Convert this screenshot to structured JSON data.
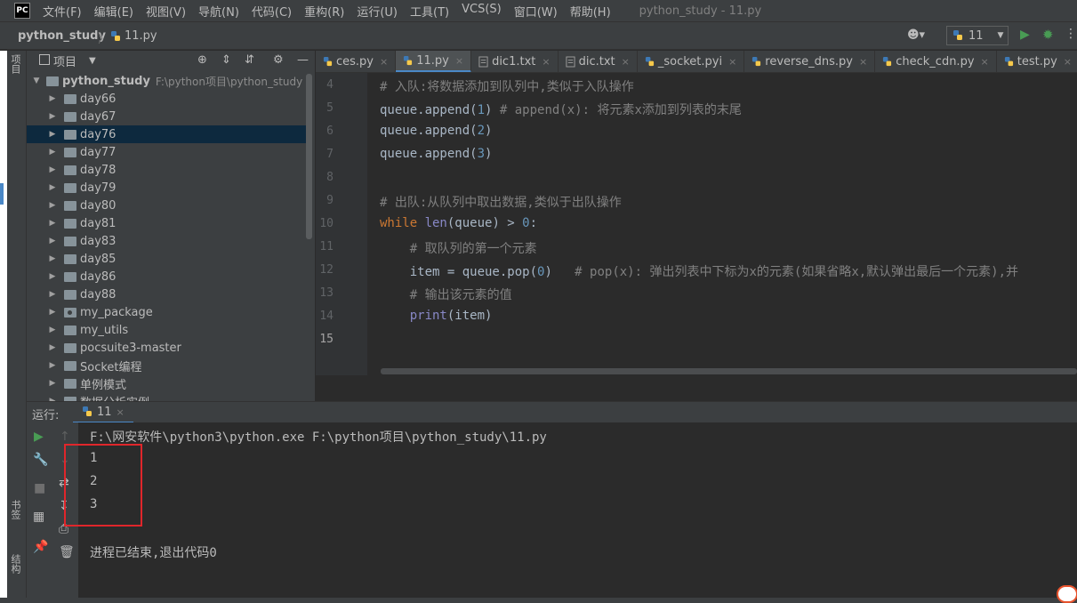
{
  "app": {
    "logo_text": "PC",
    "window_title": "python_study - 11.py",
    "menu": [
      "文件(F)",
      "编辑(E)",
      "视图(V)",
      "导航(N)",
      "代码(C)",
      "重构(R)",
      "运行(U)",
      "工具(T)",
      "VCS(S)",
      "窗口(W)",
      "帮助(H)"
    ]
  },
  "navbar": {
    "project": "python_study",
    "separator": "〉",
    "file": "11.py",
    "user_icon": "user-icon",
    "run_config": "11",
    "run_config_arrow": "▼"
  },
  "left_strip": {
    "project_tab": "项目",
    "bookmarks_tab": "书签",
    "structure_tab": "结构"
  },
  "project_panel": {
    "title": "项目",
    "dropdown": "▼",
    "root": {
      "name": "python_study",
      "path": "F:\\python项目\\python_study"
    },
    "items": [
      {
        "label": "day66",
        "selected": false,
        "package": false
      },
      {
        "label": "day67",
        "selected": false,
        "package": false
      },
      {
        "label": "day76",
        "selected": true,
        "package": false
      },
      {
        "label": "day77",
        "selected": false,
        "package": false
      },
      {
        "label": "day78",
        "selected": false,
        "package": false
      },
      {
        "label": "day79",
        "selected": false,
        "package": false
      },
      {
        "label": "day80",
        "selected": false,
        "package": false
      },
      {
        "label": "day81",
        "selected": false,
        "package": false
      },
      {
        "label": "day83",
        "selected": false,
        "package": false
      },
      {
        "label": "day85",
        "selected": false,
        "package": false
      },
      {
        "label": "day86",
        "selected": false,
        "package": false
      },
      {
        "label": "day88",
        "selected": false,
        "package": false
      },
      {
        "label": "my_package",
        "selected": false,
        "package": true
      },
      {
        "label": "my_utils",
        "selected": false,
        "package": false
      },
      {
        "label": "pocsuite3-master",
        "selected": false,
        "package": false
      },
      {
        "label": "Socket编程",
        "selected": false,
        "package": false
      },
      {
        "label": "单例模式",
        "selected": false,
        "package": false
      },
      {
        "label": "数据分析实例",
        "selected": false,
        "package": false
      }
    ]
  },
  "tabs": [
    {
      "label": "ces.py",
      "active": false,
      "kind": "py"
    },
    {
      "label": "11.py",
      "active": true,
      "kind": "py"
    },
    {
      "label": "dic1.txt",
      "active": false,
      "kind": "txt"
    },
    {
      "label": "dic.txt",
      "active": false,
      "kind": "txt"
    },
    {
      "label": "_socket.pyi",
      "active": false,
      "kind": "py"
    },
    {
      "label": "reverse_dns.py",
      "active": false,
      "kind": "py"
    },
    {
      "label": "check_cdn.py",
      "active": false,
      "kind": "py"
    },
    {
      "label": "test.py",
      "active": false,
      "kind": "py"
    }
  ],
  "tab_close": "×",
  "editor": {
    "line_numbers": [
      "4",
      "5",
      "6",
      "7",
      "8",
      "9",
      "10",
      "11",
      "12",
      "13",
      "14",
      "15"
    ],
    "lines": [
      [
        {
          "t": "# 入队:将数据添加到队列中,类似于入队操作",
          "c": "cm"
        }
      ],
      [
        {
          "t": "queue.append(",
          "c": ""
        },
        {
          "t": "1",
          "c": "num"
        },
        {
          "t": ") ",
          "c": ""
        },
        {
          "t": "# append(x): 将元素x添加到列表的末尾",
          "c": "cm"
        }
      ],
      [
        {
          "t": "queue.append(",
          "c": ""
        },
        {
          "t": "2",
          "c": "num"
        },
        {
          "t": ")",
          "c": ""
        }
      ],
      [
        {
          "t": "queue.append(",
          "c": ""
        },
        {
          "t": "3",
          "c": "num"
        },
        {
          "t": ")",
          "c": ""
        }
      ],
      [],
      [
        {
          "t": "# 出队:从队列中取出数据,类似于出队操作",
          "c": "cm"
        }
      ],
      [
        {
          "t": "while ",
          "c": "kw"
        },
        {
          "t": "len",
          "c": "bi"
        },
        {
          "t": "(queue) > ",
          "c": ""
        },
        {
          "t": "0",
          "c": "num"
        },
        {
          "t": ":",
          "c": ""
        }
      ],
      [
        {
          "t": "    # 取队列的第一个元素",
          "c": "cm"
        }
      ],
      [
        {
          "t": "    item = queue.pop(",
          "c": ""
        },
        {
          "t": "0",
          "c": "num"
        },
        {
          "t": ")   ",
          "c": ""
        },
        {
          "t": "# pop(x): 弹出列表中下标为x的元素(如果省略x,默认弹出最后一个元素),并",
          "c": "cm"
        }
      ],
      [
        {
          "t": "    # 输出该元素的值",
          "c": "cm"
        }
      ],
      [
        {
          "t": "    ",
          "c": ""
        },
        {
          "t": "print",
          "c": "bi"
        },
        {
          "t": "(item)",
          "c": ""
        }
      ],
      []
    ]
  },
  "run_panel": {
    "label": "运行:",
    "tab": "11",
    "tab_close": "×",
    "output": [
      "F:\\网安软件\\python3\\python.exe F:\\python项目\\python_study\\11.py",
      "1",
      "2",
      "3",
      "",
      "进程已结束,退出代码0"
    ]
  }
}
